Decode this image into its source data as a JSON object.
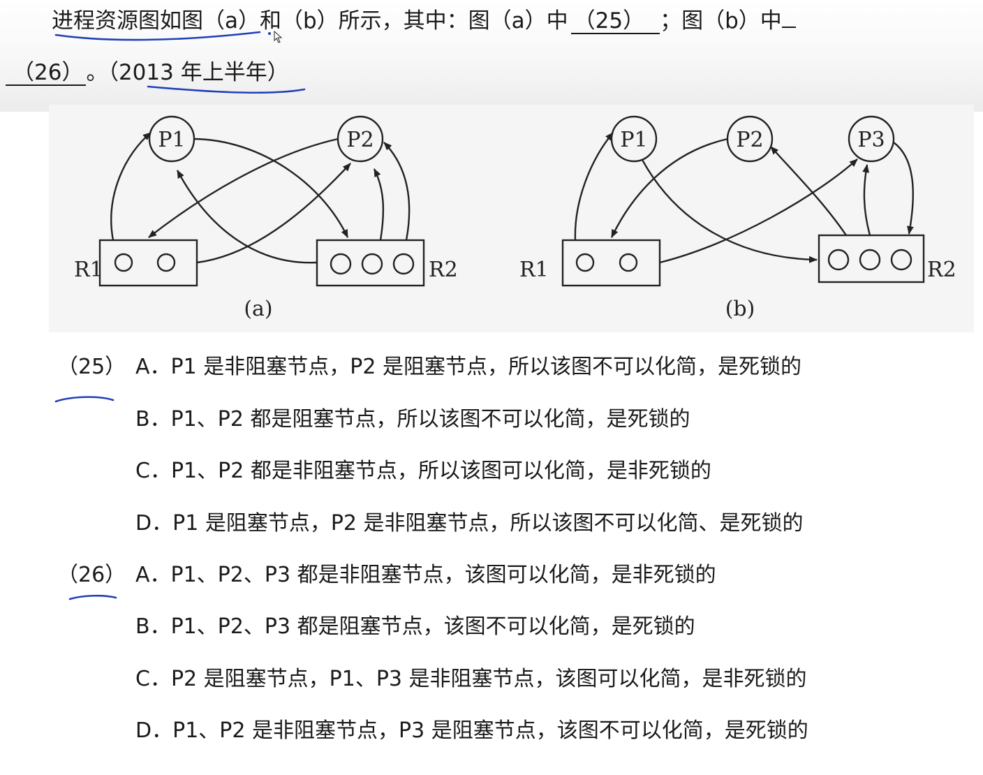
{
  "question": {
    "line1_text": "进程资源图如图（a）和（b）所示，其中：图（a）中",
    "blank25": "（25）",
    "line1_mid": "；图（b）中",
    "blank26": "（26）",
    "line2_tail": "。（2013 年上半年）"
  },
  "diagrams": {
    "a": {
      "caption": "(a)",
      "processes": [
        "P1",
        "P2"
      ],
      "resources": [
        {
          "label": "R1",
          "instances": 2
        },
        {
          "label": "R2",
          "instances": 3
        }
      ]
    },
    "b": {
      "caption": "(b)",
      "processes": [
        "P1",
        "P2",
        "P3"
      ],
      "resources": [
        {
          "label": "R1",
          "instances": 2
        },
        {
          "label": "R2",
          "instances": 3
        }
      ]
    }
  },
  "q25": {
    "number": "（25）",
    "options": [
      "A．P1 是非阻塞节点，P2 是阻塞节点，所以该图不可以化简，是死锁的",
      "B．P1、P2 都是阻塞节点，所以该图不可以化简，是死锁的",
      "C．P1、P2 都是非阻塞节点，所以该图可以化简，是非死锁的",
      "D．P1 是阻塞节点，P2 是非阻塞节点，所以该图不可以化简、是死锁的"
    ]
  },
  "q26": {
    "number": "（26）",
    "options": [
      "A．P1、P2、P3 都是非阻塞节点，该图可以化简，是非死锁的",
      "B．P1、P2、P3 都是阻塞节点，该图不可以化简，是死锁的",
      "C．P2 是阻塞节点，P1、P3 是非阻塞节点，该图可以化简，是非死锁的",
      "D．P1、P2 是非阻塞节点，P3 是阻塞节点，该图不可以化简，是死锁的"
    ]
  },
  "colors": {
    "ink_annotation": "#1f3fb8",
    "text": "#1a1a1a",
    "diagram_bg": "#f5f5f5"
  }
}
